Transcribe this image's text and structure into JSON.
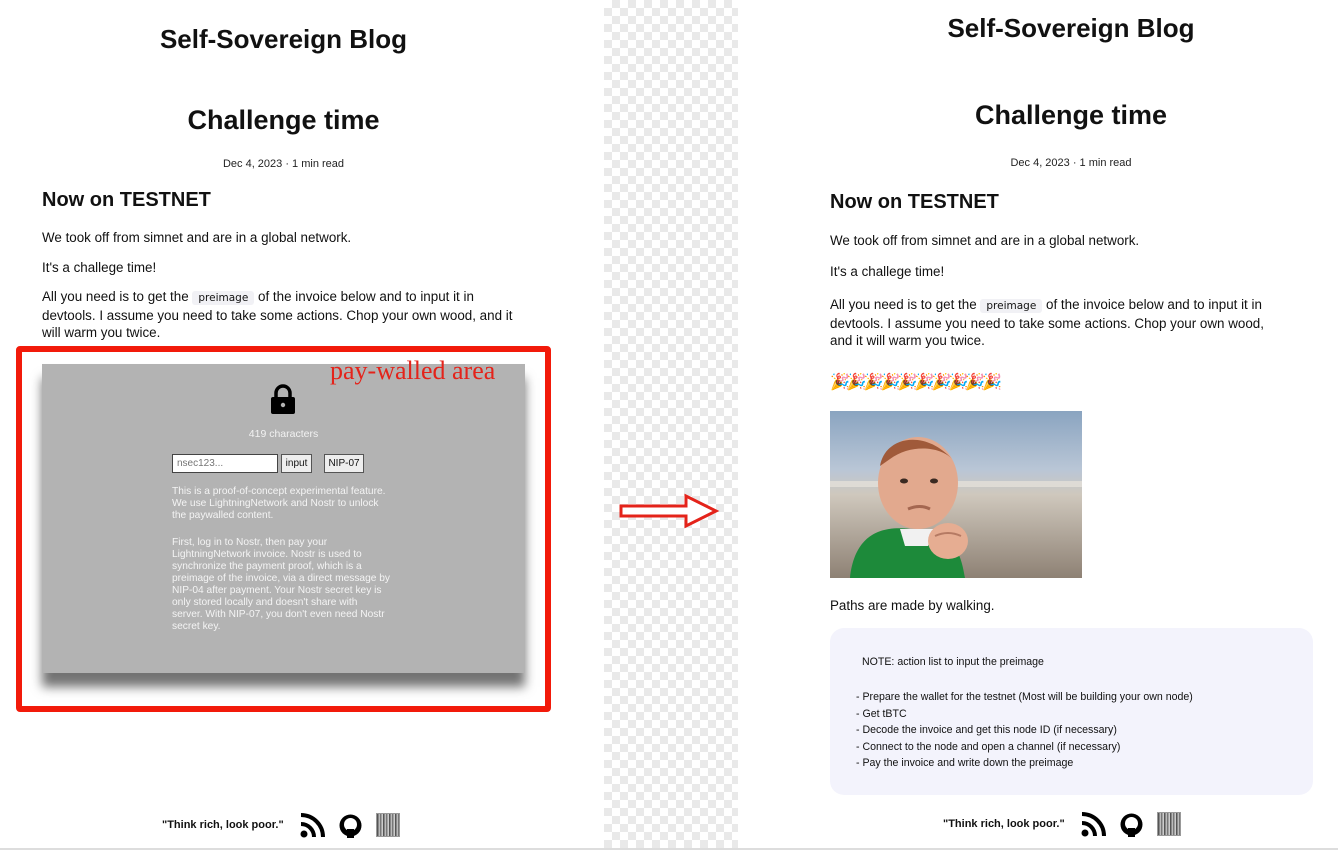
{
  "left": {
    "blog_title": "Self-Sovereign Blog",
    "post_title": "Challenge time",
    "date": "Dec 4, 2023 · 1 min read",
    "section": "Now on TESTNET",
    "para1": "We took off from simnet and are in a global network.",
    "para2": "It's a challege time!",
    "para3_before": "All you need is to get the",
    "para3_code": "preimage",
    "para3_line1_after": "of the invoice below and to input it in",
    "para3_line2": "devtools. I assume you need to take some actions. Chop your own wood, and it",
    "para3_line3": "will warm you twice.",
    "paywall": {
      "annotation": "pay-walled area",
      "characters": "419 characters",
      "nsec_placeholder": "nsec123...",
      "input_button": "input",
      "nip07_button": "NIP-07",
      "desc1": "This is a proof-of-concept experimental feature. We use LightningNetwork and Nostr to unlock the paywalled content.",
      "desc2": "First, log in to Nostr, then pay your LightningNetwork invoice. Nostr is used to synchronize the payment proof, which is a preimage of the invoice, via a direct message by NIP-04 after payment. Your Nostr secret key is only stored locally and doesn't share with server. With NIP-07, you don't even need Nostr secret key."
    },
    "footer_quote": "\"Think rich, look poor.\""
  },
  "right": {
    "blog_title": "Self-Sovereign Blog",
    "post_title": "Challenge time",
    "date": "Dec 4, 2023 · 1 min read",
    "section": "Now on TESTNET",
    "para1": "We took off from simnet and are in a global network.",
    "para2": "It's a challege time!",
    "para3_before": "All you need is to get the",
    "para3_code": "preimage",
    "para3_line1_after": "of the invoice below and to input it in",
    "para3_line2": "devtools. I assume you need to take some actions. Chop your own wood,",
    "para3_line3": "and it will warm you twice.",
    "emojis": "🎉🎉🎉🎉🎉🎉🎉🎉🎉🎉",
    "paths": "Paths are made by walking.",
    "note_head": "NOTE: action list to input the preimage",
    "note_items": [
      "- Prepare the wallet for the testnet (Most will be building your own node)",
      "- Get tBTC",
      "- Decode the invoice and get this node ID (if necessary)",
      "- Connect to the node and open a channel (if necessary)",
      "- Pay the invoice and write down the preimage"
    ],
    "footer_quote": "\"Think rich, look poor.\""
  },
  "icons": {
    "rss": "rss-icon",
    "github": "github-icon",
    "qr": "qr-code-icon",
    "lock": "lock-icon",
    "arrow": "arrow-right-icon"
  },
  "colors": {
    "annotation_red": "#f21a0a",
    "paywall_gray": "#b3b3b3",
    "note_bg": "#f3f3fc"
  }
}
